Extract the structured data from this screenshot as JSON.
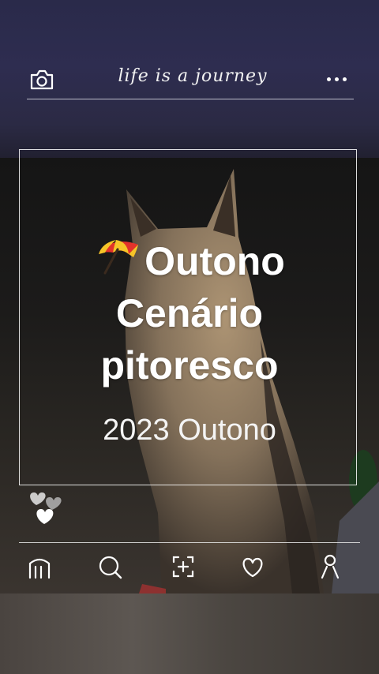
{
  "header": {
    "brand_text": "life is a journey",
    "camera_icon": "camera-icon",
    "more_icon": "more-horizontal-icon"
  },
  "card": {
    "title_line1": "Outono",
    "title_line2": "Cenário",
    "title_line3": "pitoresco",
    "title_emoji": "umbrella-on-ground-icon",
    "subtitle": "2023 Outono"
  },
  "reactions": {
    "icon": "hearts-icon"
  },
  "bottom_nav": {
    "items": [
      {
        "icon": "home-icon"
      },
      {
        "icon": "search-icon"
      },
      {
        "icon": "add-photo-icon"
      },
      {
        "icon": "heart-icon"
      },
      {
        "icon": "profile-icon"
      }
    ]
  },
  "colors": {
    "sky": "#2e2d50",
    "ground": "#1c1b1a",
    "text": "#ffffff",
    "umbrella_red": "#e2322b",
    "umbrella_yellow": "#f6c428"
  }
}
